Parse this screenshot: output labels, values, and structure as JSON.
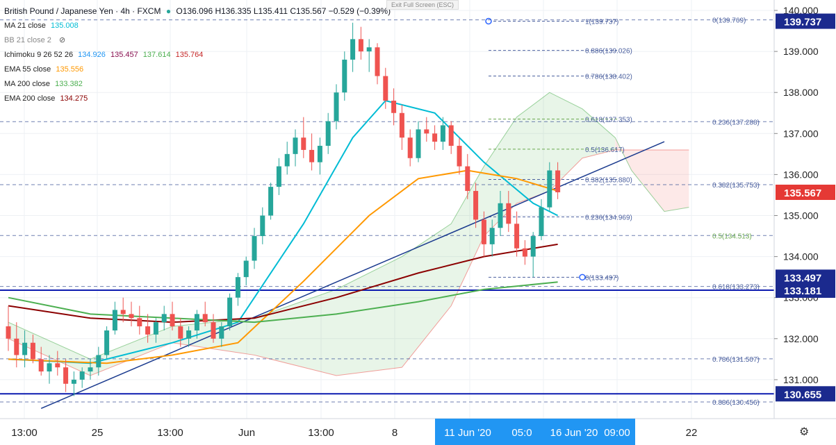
{
  "header": {
    "symbol": "British Pound / Japanese Yen · 4h · FXCM",
    "ohlc": "O136.096  H136.335  L135.411  C135.567  −0.529 (−0.39%)",
    "exit_fullscreen": "Exit Full Screen (ESC)"
  },
  "legend": [
    {
      "label": "MA 21 close",
      "value": "135.008",
      "color": "#00bcd4"
    },
    {
      "label": "BB 21 close 2",
      "value": "",
      "color": "#888888"
    },
    {
      "label": "Ichimoku 9 26 52 26",
      "values": [
        "134.926",
        "135.457",
        "137.614",
        "135.764"
      ],
      "colors": [
        "#2196f3",
        "#880e4f",
        "#4caf50",
        "#c62828"
      ]
    },
    {
      "label": "EMA 55 close",
      "value": "135.556",
      "color": "#ff9800"
    },
    {
      "label": "MA 200 close",
      "value": "133.382",
      "color": "#4caf50"
    },
    {
      "label": "EMA 200 close",
      "value": "134.275",
      "color": "#8b0000"
    }
  ],
  "colors": {
    "up": "#26a69a",
    "down": "#ef5350",
    "blueline": "#0d1bb0",
    "trend": "#1a3a8e",
    "ma21": "#00bcd4",
    "ema55": "#ff9800",
    "ma200": "#4caf50",
    "ema200": "#8b0000",
    "fib": "#4a5f9e",
    "fib2": "#6aa84f",
    "price_tag": "#e53935",
    "level_tag": "#1b2a8e",
    "axis_text": "#222222"
  },
  "chart_data": {
    "type": "candlestick",
    "title": "British Pound / Japanese Yen · 4h · FXCM",
    "ylim": [
      130.3,
      140.3
    ],
    "x_ticks": [
      "13:00",
      "25",
      "13:00",
      "Jun",
      "13:00",
      "8",
      "11 Jun '20",
      "05:0",
      "16 Jun '20",
      "09:00",
      "22"
    ],
    "y_ticks": [
      "131.000",
      "132.000",
      "133.000",
      "134.000",
      "135.000",
      "136.000",
      "137.000",
      "138.000",
      "139.000",
      "140.000"
    ],
    "axis_tags": [
      {
        "label": "139.737",
        "value": 139.737,
        "type": "level"
      },
      {
        "label": "135.567",
        "value": 135.567,
        "type": "price"
      },
      {
        "label": "133.497",
        "value": 133.497,
        "type": "level"
      },
      {
        "label": "133.181",
        "value": 133.181,
        "type": "level"
      },
      {
        "label": "130.655",
        "value": 130.655,
        "type": "level"
      }
    ],
    "horizontal_lines": [
      133.181,
      130.655
    ],
    "fib_retracement_1": [
      {
        "label": "1(139.737)",
        "value": 139.737
      },
      {
        "label": "0.886(139.026)",
        "value": 139.026
      },
      {
        "label": "0.786(138.402)",
        "value": 138.402
      },
      {
        "label": "0.618(137.353)",
        "value": 137.353
      },
      {
        "label": "0.5(136.617)",
        "value": 136.617
      },
      {
        "label": "0.382(135.880)",
        "value": 135.88
      },
      {
        "label": "0.236(134.969)",
        "value": 134.969
      },
      {
        "label": "0(133.497)",
        "value": 133.497
      }
    ],
    "fib_retracement_2": [
      {
        "label": "0(139.769)",
        "value": 139.769
      },
      {
        "label": "0.236(137.288)",
        "value": 137.288
      },
      {
        "label": "0.382(135.753)",
        "value": 135.753
      },
      {
        "label": "0.5(134.513)",
        "value": 134.513
      },
      {
        "label": "0.618(133.273)",
        "value": 133.273
      },
      {
        "label": "0.786(131.507)",
        "value": 131.507
      },
      {
        "label": "0.886(130.456)",
        "value": 130.456
      }
    ],
    "candles": [
      [
        132.3,
        132.8,
        131.7,
        132.0
      ],
      [
        132.0,
        132.4,
        131.3,
        131.6
      ],
      [
        131.6,
        132.2,
        131.3,
        131.9
      ],
      [
        131.9,
        132.1,
        131.4,
        131.5
      ],
      [
        131.5,
        131.8,
        131.1,
        131.2
      ],
      [
        131.2,
        131.6,
        130.9,
        131.4
      ],
      [
        131.4,
        131.7,
        131.1,
        131.3
      ],
      [
        131.3,
        131.5,
        130.7,
        130.9
      ],
      [
        130.9,
        131.2,
        130.6,
        131.0
      ],
      [
        131.0,
        131.3,
        130.8,
        131.2
      ],
      [
        131.2,
        131.5,
        131.0,
        131.3
      ],
      [
        131.3,
        131.8,
        131.1,
        131.6
      ],
      [
        131.6,
        132.3,
        131.5,
        132.2
      ],
      [
        132.2,
        132.9,
        132.1,
        132.7
      ],
      [
        132.7,
        133.0,
        132.4,
        132.6
      ],
      [
        132.6,
        132.9,
        132.3,
        132.5
      ],
      [
        132.5,
        132.8,
        132.1,
        132.3
      ],
      [
        132.3,
        132.6,
        131.9,
        132.1
      ],
      [
        132.1,
        132.5,
        131.9,
        132.4
      ],
      [
        132.4,
        132.8,
        132.2,
        132.6
      ],
      [
        132.6,
        132.9,
        132.2,
        132.3
      ],
      [
        132.3,
        132.5,
        131.8,
        132.0
      ],
      [
        132.0,
        132.3,
        131.8,
        132.2
      ],
      [
        132.2,
        132.7,
        132.0,
        132.6
      ],
      [
        132.6,
        132.9,
        132.3,
        132.4
      ],
      [
        132.4,
        132.6,
        131.9,
        132.0
      ],
      [
        132.0,
        132.4,
        131.8,
        132.3
      ],
      [
        132.3,
        133.1,
        132.2,
        133.0
      ],
      [
        133.0,
        133.6,
        132.8,
        133.5
      ],
      [
        133.5,
        134.0,
        133.3,
        133.9
      ],
      [
        133.9,
        134.7,
        133.7,
        134.5
      ],
      [
        134.5,
        135.2,
        134.3,
        135.0
      ],
      [
        135.0,
        135.8,
        134.9,
        135.7
      ],
      [
        135.7,
        136.4,
        135.5,
        136.2
      ],
      [
        136.2,
        136.8,
        136.0,
        136.5
      ],
      [
        136.5,
        137.1,
        136.2,
        136.9
      ],
      [
        136.9,
        137.4,
        136.4,
        136.6
      ],
      [
        136.6,
        137.0,
        136.1,
        136.3
      ],
      [
        136.3,
        136.9,
        136.0,
        136.7
      ],
      [
        136.7,
        137.5,
        136.5,
        137.3
      ],
      [
        137.3,
        138.2,
        137.1,
        138.0
      ],
      [
        138.0,
        139.0,
        137.8,
        138.8
      ],
      [
        138.8,
        139.7,
        138.5,
        139.3
      ],
      [
        139.3,
        139.6,
        138.8,
        139.0
      ],
      [
        139.0,
        139.3,
        138.5,
        139.1
      ],
      [
        139.1,
        139.2,
        138.2,
        138.4
      ],
      [
        138.4,
        138.6,
        137.6,
        137.8
      ],
      [
        137.8,
        138.1,
        137.2,
        137.5
      ],
      [
        137.5,
        137.7,
        136.6,
        136.9
      ],
      [
        136.9,
        137.1,
        136.2,
        136.4
      ],
      [
        136.4,
        137.3,
        136.3,
        137.1
      ],
      [
        137.1,
        137.4,
        136.8,
        137.0
      ],
      [
        137.0,
        137.2,
        136.6,
        136.8
      ],
      [
        136.8,
        137.4,
        136.6,
        137.2
      ],
      [
        137.2,
        137.3,
        136.5,
        136.7
      ],
      [
        136.7,
        136.9,
        136.0,
        136.2
      ],
      [
        136.2,
        136.5,
        135.4,
        135.6
      ],
      [
        135.6,
        135.8,
        134.7,
        134.9
      ],
      [
        134.9,
        135.1,
        134.0,
        134.3
      ],
      [
        134.3,
        134.9,
        134.0,
        134.7
      ],
      [
        134.7,
        135.6,
        134.5,
        135.3
      ],
      [
        135.3,
        135.6,
        134.6,
        134.8
      ],
      [
        134.8,
        135.1,
        134.0,
        134.2
      ],
      [
        134.2,
        134.4,
        133.8,
        134.0
      ],
      [
        134.0,
        134.6,
        133.5,
        134.5
      ],
      [
        134.5,
        135.4,
        134.4,
        135.2
      ],
      [
        135.2,
        136.3,
        135.1,
        136.1
      ],
      [
        136.1,
        136.3,
        135.4,
        135.567
      ]
    ],
    "series": [
      {
        "name": "MA 21 close",
        "color": "#00bcd4",
        "points": [
          [
            0,
            131.5
          ],
          [
            10,
            131.4
          ],
          [
            20,
            131.9
          ],
          [
            28,
            132.4
          ],
          [
            36,
            134.8
          ],
          [
            42,
            136.9
          ],
          [
            46,
            137.8
          ],
          [
            52,
            137.5
          ],
          [
            58,
            136.3
          ],
          [
            64,
            135.3
          ],
          [
            67,
            135.0
          ]
        ]
      },
      {
        "name": "EMA 55 close",
        "color": "#ff9800",
        "points": [
          [
            0,
            131.5
          ],
          [
            12,
            131.4
          ],
          [
            20,
            131.6
          ],
          [
            28,
            131.9
          ],
          [
            36,
            133.4
          ],
          [
            44,
            135.0
          ],
          [
            50,
            135.9
          ],
          [
            56,
            136.1
          ],
          [
            62,
            135.9
          ],
          [
            67,
            135.6
          ]
        ]
      },
      {
        "name": "EMA 200 close",
        "color": "#8b0000",
        "points": [
          [
            0,
            132.8
          ],
          [
            10,
            132.5
          ],
          [
            20,
            132.4
          ],
          [
            30,
            132.5
          ],
          [
            40,
            133.0
          ],
          [
            50,
            133.6
          ],
          [
            58,
            134.0
          ],
          [
            67,
            134.3
          ]
        ]
      },
      {
        "name": "MA 200 close",
        "color": "#4caf50",
        "points": [
          [
            0,
            133.0
          ],
          [
            10,
            132.6
          ],
          [
            20,
            132.5
          ],
          [
            30,
            132.4
          ],
          [
            40,
            132.6
          ],
          [
            50,
            132.9
          ],
          [
            58,
            133.2
          ],
          [
            67,
            133.38
          ]
        ]
      }
    ],
    "trendline": [
      [
        4,
        130.3
      ],
      [
        80,
        136.8
      ]
    ],
    "cloud": [
      {
        "x": 0,
        "a": 132.4,
        "b": 132.0
      },
      {
        "x": 10,
        "a": 131.5,
        "b": 131.1
      },
      {
        "x": 20,
        "a": 132.3,
        "b": 131.9
      },
      {
        "x": 30,
        "a": 132.5,
        "b": 131.6
      },
      {
        "x": 40,
        "a": 133.2,
        "b": 131.1
      },
      {
        "x": 48,
        "a": 134.0,
        "b": 131.3
      },
      {
        "x": 54,
        "a": 134.8,
        "b": 132.8
      },
      {
        "x": 58,
        "a": 136.2,
        "b": 134.5
      },
      {
        "x": 62,
        "a": 137.4,
        "b": 135.3
      },
      {
        "x": 66,
        "a": 138.0,
        "b": 135.6
      },
      {
        "x": 70,
        "a": 137.6,
        "b": 136.4
      },
      {
        "x": 74,
        "a": 136.9,
        "b": 136.6
      },
      {
        "x": 76,
        "a": 136.1,
        "b": 136.6
      },
      {
        "x": 80,
        "a": 135.1,
        "b": 136.6
      },
      {
        "x": 83,
        "a": 135.2,
        "b": 136.6
      }
    ]
  }
}
